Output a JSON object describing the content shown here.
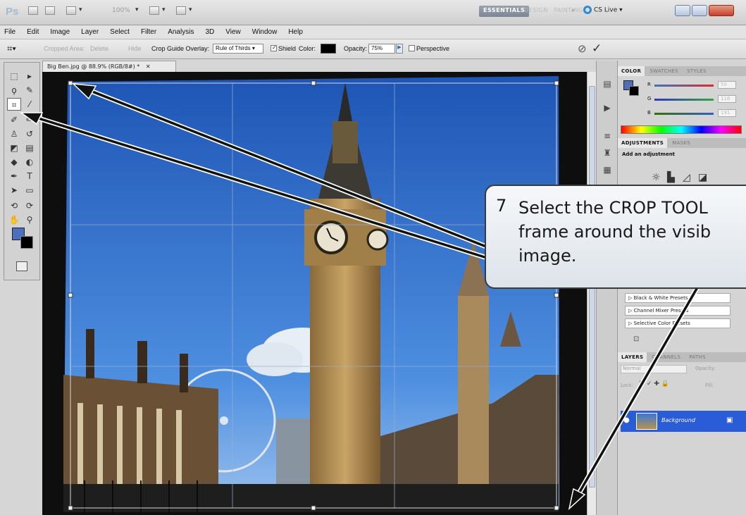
{
  "app": {
    "logo": "Ps",
    "zoom": "100%",
    "workspaces": [
      "ESSENTIALS",
      "DESIGN",
      "PAINTING",
      "»"
    ],
    "cs_live": "CS Live"
  },
  "menu": [
    "File",
    "Edit",
    "Image",
    "Layer",
    "Select",
    "Filter",
    "Analysis",
    "3D",
    "View",
    "Window",
    "Help"
  ],
  "options": {
    "cropped_area": "Cropped Area:",
    "delete": "Delete",
    "hide": "Hide",
    "guide_overlay_label": "Crop Guide Overlay:",
    "guide_overlay_value": "Rule of Thirds",
    "shield": "Shield",
    "color_label": "Color:",
    "opacity_label": "Opacity:",
    "opacity_value": "75%",
    "perspective": "Perspective"
  },
  "document": {
    "tab_title": "Big Ben.jpg @ 88.9% (RGB/8#) *",
    "crop": {
      "guides": "rule-of-thirds"
    }
  },
  "panels": {
    "color_tabs": [
      "COLOR",
      "SWATCHES",
      "STYLES"
    ],
    "rgb": [
      {
        "label": "R",
        "value": "50",
        "color": "#e0282b"
      },
      {
        "label": "G",
        "value": "116",
        "color": "#2ea83a"
      },
      {
        "label": "B",
        "value": "191",
        "color": "#2f5fcf"
      }
    ],
    "adjust_tabs": [
      "ADJUSTMENTS",
      "MASKS"
    ],
    "add_adjustment": "Add an adjustment",
    "presets": [
      "Black & White Presets",
      "Channel Mixer Presets",
      "Selective Color Presets"
    ],
    "layers_tabs": [
      "LAYERS",
      "CHANNELS",
      "PATHS"
    ],
    "layers_blend": "Normal",
    "layers_opacity": "Opacity:",
    "layers_fill": "Fill:",
    "lock_label": "Lock:",
    "layer_name": "Background"
  },
  "callout": {
    "number": "7",
    "text": "Select the CROP TOOL\nframe around the visib\nimage."
  },
  "colors": {
    "accent": "#4d6fbd",
    "sky": "#3d7fd6",
    "layer_selected": "#2b5cd8"
  }
}
